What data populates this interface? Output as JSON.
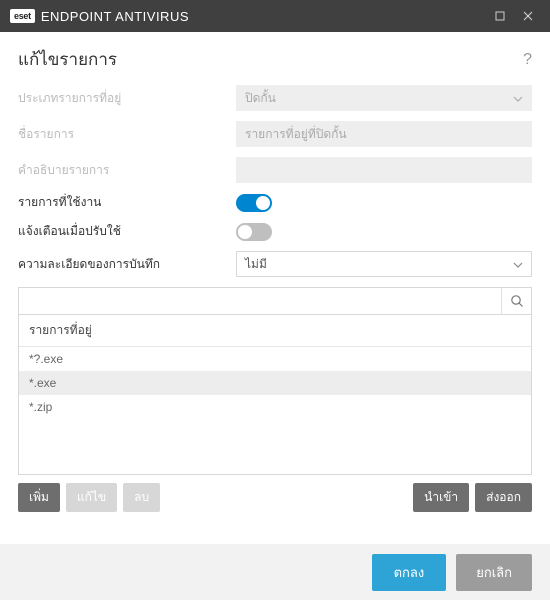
{
  "titlebar": {
    "logo": "eset",
    "title": "ENDPOINT ANTIVIRUS"
  },
  "header": {
    "title": "แก้ไขรายการ",
    "help": "?"
  },
  "form": {
    "type_label": "ประเภทรายการที่อยู่",
    "type_value": "ปิดกั้น",
    "name_label": "ชื่อรายการ",
    "name_value": "รายการที่อยู่ที่ปิดกั้น",
    "desc_label": "คำอธิบายรายการ",
    "desc_value": "",
    "active_label": "รายการที่ใช้งาน",
    "notify_label": "แจ้งเตือนเมื่อปรับใช้",
    "log_label": "ความละเอียดของการบันทึก",
    "log_value": "ไม่มี"
  },
  "list": {
    "header": "รายการที่อยู่",
    "items": [
      "*?.exe",
      "*.exe",
      "*.zip"
    ],
    "selected_index": 1
  },
  "list_buttons": {
    "add": "เพิ่ม",
    "edit": "แก้ไข",
    "remove": "ลบ",
    "import": "นำเข้า",
    "export": "ส่งออก"
  },
  "footer": {
    "ok": "ตกลง",
    "cancel": "ยกเลิก"
  }
}
